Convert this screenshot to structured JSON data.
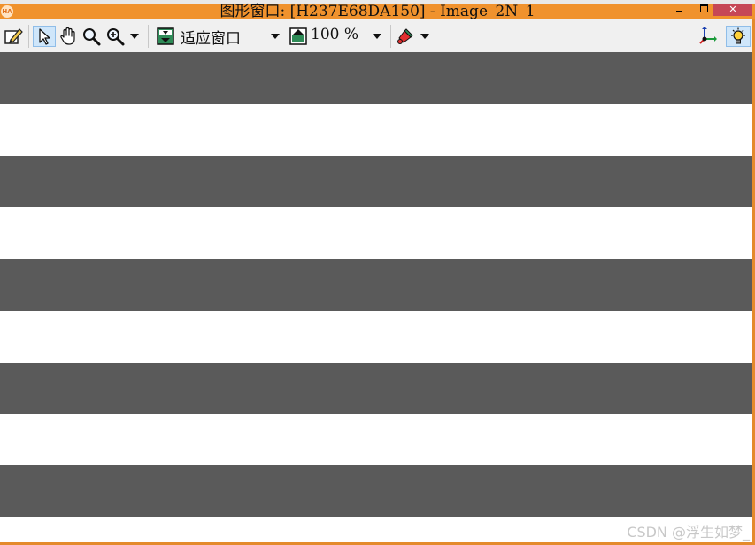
{
  "window": {
    "title": "图形窗口: [H237E68DA150] - Image_2N_1",
    "app_logo_text": "HA",
    "close_glyph": "✕",
    "titlebar_color": "#f0922d"
  },
  "toolbar": {
    "items": [
      {
        "name": "edit-draw-icon"
      },
      {
        "name": "pointer-select-icon",
        "selected": true
      },
      {
        "name": "hand-pan-icon"
      },
      {
        "name": "magnifier-icon"
      },
      {
        "name": "zoom-in-icon"
      },
      {
        "name": "fit-window-icon"
      },
      {
        "name": "zoom-percent-icon"
      },
      {
        "name": "color-brush-icon"
      },
      {
        "name": "axes-icon"
      },
      {
        "name": "lightbulb-icon"
      }
    ],
    "fit_label": "适应窗口",
    "zoom_label": "100 %"
  },
  "image": {
    "stripe_color": "#5a5a5a",
    "background_color": "#ffffff",
    "stripe_count": 5
  },
  "watermark": "CSDN @浮生如梦_"
}
